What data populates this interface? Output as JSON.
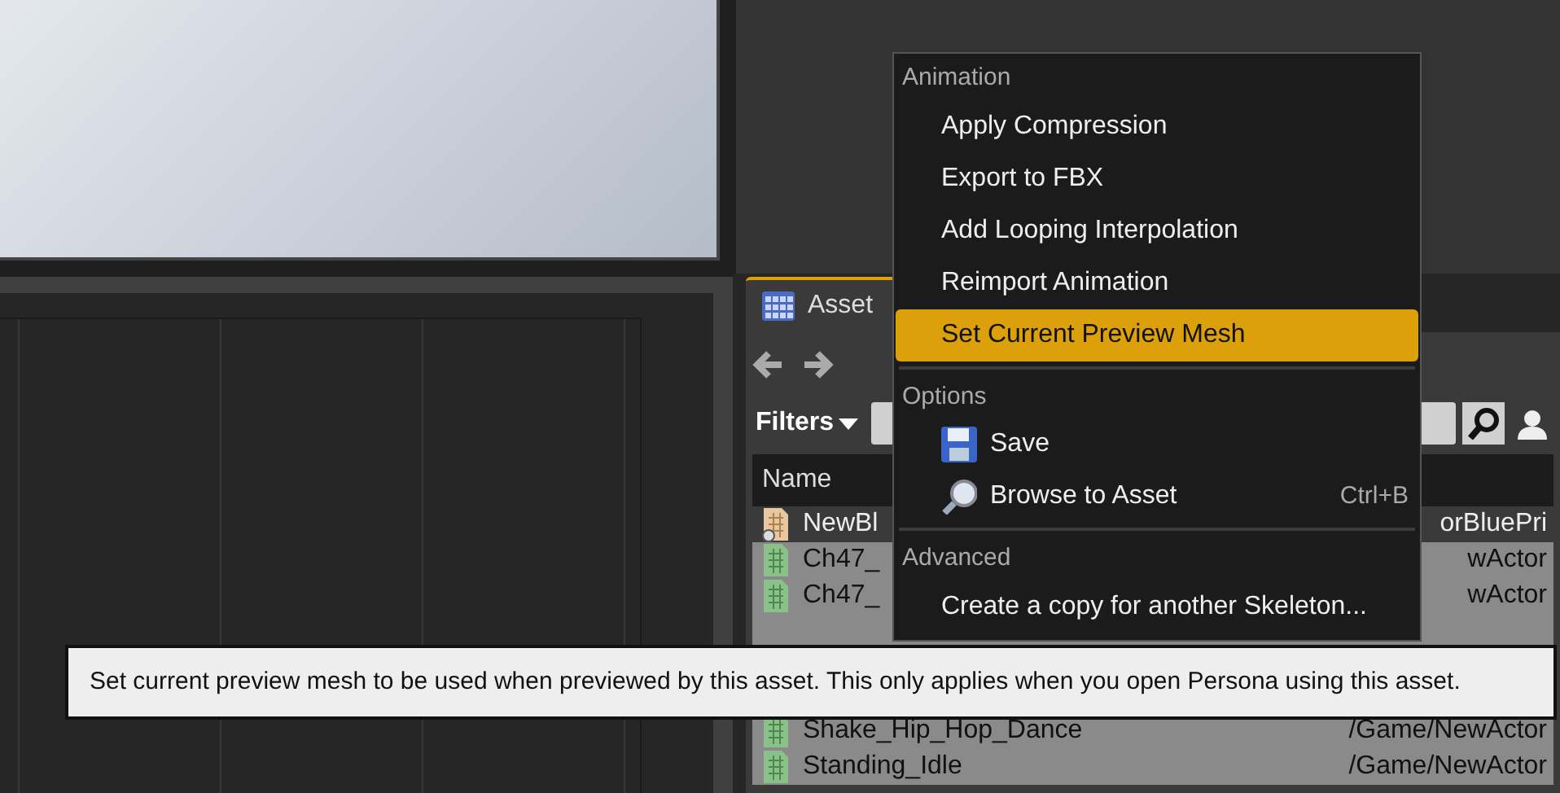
{
  "asset_browser": {
    "tab": {
      "label": "Asset",
      "selected": true
    },
    "filters": {
      "label": "Filters"
    },
    "column_header": "Name",
    "rows": [
      {
        "kind": "blueprint",
        "name": "NewBl",
        "path": "orBluePri",
        "selected": false
      },
      {
        "kind": "animation",
        "name": "Ch47_",
        "path": "wActor",
        "selected": true
      },
      {
        "kind": "animation",
        "name": "Ch47_",
        "path": "wActor",
        "selected": true
      },
      {
        "kind": "animation",
        "name": "Shake_Hip_Hop_Dance",
        "path": "/Game/NewActor",
        "selected": true
      },
      {
        "kind": "animation",
        "name": "Standing_Idle",
        "path": "/Game/NewActor",
        "selected": true
      }
    ]
  },
  "context_menu": {
    "sections": [
      {
        "heading": "Animation",
        "items": [
          {
            "kind": "plain",
            "label": "Apply Compression",
            "selected": false
          },
          {
            "kind": "plain",
            "label": "Export to FBX",
            "selected": false
          },
          {
            "kind": "plain",
            "label": "Add Looping Interpolation",
            "selected": false
          },
          {
            "kind": "plain",
            "label": "Reimport Animation",
            "selected": false
          },
          {
            "kind": "plain",
            "label": "Set Current Preview Mesh",
            "selected": true
          }
        ]
      },
      {
        "heading": "Options",
        "items": [
          {
            "kind": "save",
            "label": "Save",
            "selected": false
          },
          {
            "kind": "browse",
            "label": "Browse to Asset",
            "shortcut": "Ctrl+B",
            "selected": false
          }
        ]
      },
      {
        "heading": "Advanced",
        "items": [
          {
            "kind": "plain",
            "label": "Create a copy for another Skeleton...",
            "selected": false
          }
        ]
      }
    ]
  },
  "tooltip": {
    "text": "Set current preview mesh to be used when previewed by this asset. This only applies when you open Persona using this asset."
  }
}
